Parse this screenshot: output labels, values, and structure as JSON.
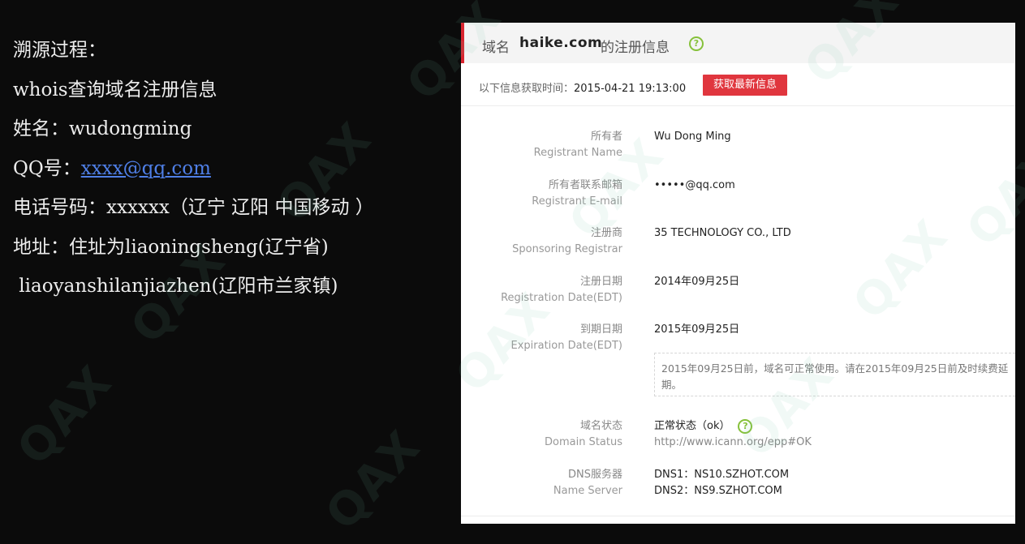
{
  "notes": {
    "line1": "溯源过程：",
    "line2": "whois查询域名注册信息",
    "line3": "姓名：wudongming",
    "line4_prefix": "QQ号：",
    "line4_link": "xxxx@qq.com",
    "line5": "电话号码：xxxxxx（辽宁 辽阳 中国移动 ）",
    "line6": "地址：住址为liaoningsheng(辽宁省)",
    "line7": " liaoyanshilanjiazhen(辽阳市兰家镇)"
  },
  "watermark": "QAX",
  "panel": {
    "title_prefix": "域名",
    "domain": "haike.com",
    "title_suffix": "的注册信息",
    "help_glyph": "?",
    "fetch_label": "以下信息获取时间：",
    "fetch_time": "2015-04-21 19:13:00",
    "refresh_button": "获取最新信息",
    "rows": [
      {
        "cn": "所有者",
        "en": "Registrant Name",
        "value": "Wu Dong Ming"
      },
      {
        "cn": "所有者联系邮箱",
        "en": "Registrant E-mail",
        "value": "•••••@qq.com"
      },
      {
        "cn": "注册商",
        "en": "Sponsoring Registrar",
        "value": "35 TECHNOLOGY CO., LTD"
      },
      {
        "cn": "注册日期",
        "en": "Registration Date(EDT)",
        "value": "2014年09月25日"
      },
      {
        "cn": "到期日期",
        "en": "Expiration Date(EDT)",
        "value": "2015年09月25日"
      }
    ],
    "expiry_note": "2015年09月25日前，域名可正常使用。请在2015年09月25日前及时续费延期。",
    "status": {
      "cn": "域名状态",
      "en": "Domain Status",
      "value": "正常状态（ok）",
      "link": "http://www.icann.org/epp#OK"
    },
    "dns": {
      "cn": "DNS服务器",
      "en": "Name Server",
      "ns1": "DNS1：NS10.SZHOT.COM",
      "ns2": "DNS2：NS9.SZHOT.COM"
    }
  }
}
